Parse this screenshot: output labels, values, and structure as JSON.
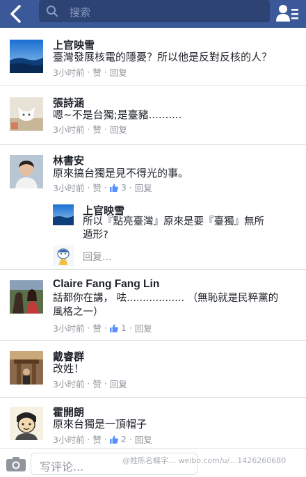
{
  "colors": {
    "brand": "#3b5998",
    "meta": "#90949c",
    "text": "#1d2129"
  },
  "topbar": {
    "search_placeholder": "搜索"
  },
  "comments": [
    {
      "author": "上官映雪",
      "text": "臺灣發展核電的隱憂？所以他是反對反核的人？",
      "time": "3小时前",
      "like": "赞",
      "like_count": "",
      "reply": "回复",
      "avatar": "blue-sky-avatar"
    },
    {
      "author": "張詩涵",
      "text": "嗯~不是台獨;是臺豬..........",
      "time": "3小时前",
      "like": "赞",
      "like_count": "",
      "reply": "回复",
      "avatar": "cat-avatar"
    },
    {
      "author": "林書安",
      "text": "原來搞台獨是見不得光的事。",
      "time": "3小时前",
      "like": "赞",
      "like_count": "3",
      "reply": "回复",
      "avatar": "man-avatar",
      "reply_item": {
        "author": "上官映雪",
        "text_line1": "所以『點亮臺灣』原來是要『臺獨』無所",
        "text_line2": "遁形?"
      },
      "reply_placeholder": "回复..."
    },
    {
      "author": "Claire Fang Fang Lin",
      "text_line1": "話都你在講，   呿..................   （無恥就是民粹黨的",
      "text_line2": "風格之一）",
      "time": "3小时前",
      "like": "赞",
      "like_count": "1",
      "reply": "回复",
      "avatar": "horse-avatar"
    },
    {
      "author": "戴睿群",
      "text": "改姓！",
      "time": "3小时前",
      "like": "赞",
      "like_count": "",
      "reply": "回复",
      "avatar": "temple-avatar"
    },
    {
      "author": "霍開朗",
      "text": "原來台獨是一頂帽子",
      "time": "3小时前",
      "like": "赞",
      "like_count": "2",
      "reply": "回复",
      "avatar": "cartoon-avatar"
    }
  ],
  "composer": {
    "placeholder": "写评论..."
  },
  "watermark": "@姓陈名蝶字…  weibo.com/u/…1426260680"
}
